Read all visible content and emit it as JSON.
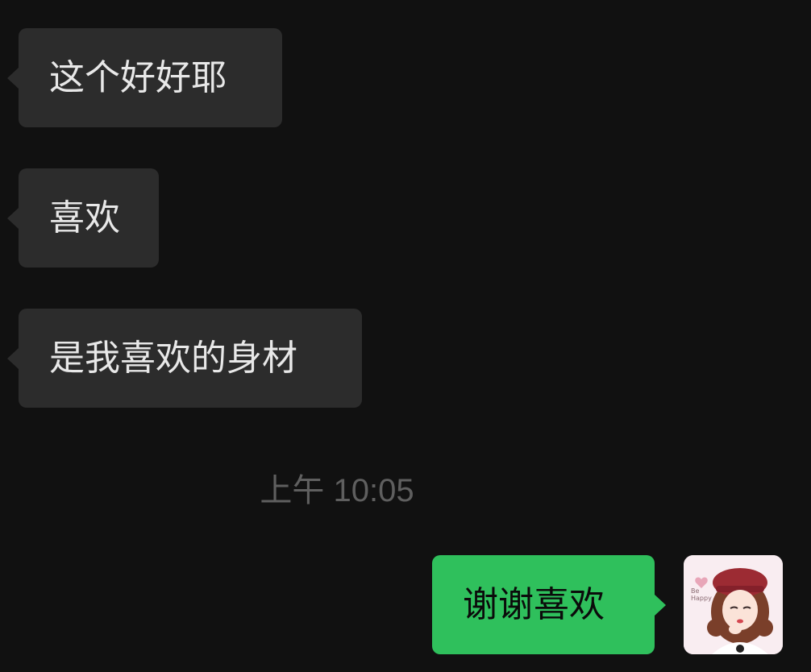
{
  "messages": [
    {
      "side": "incoming",
      "text": "这个好好耶"
    },
    {
      "side": "incoming",
      "text": "喜欢"
    },
    {
      "side": "incoming",
      "text": "是我喜欢的身材"
    },
    {
      "side": "outgoing",
      "text": "谢谢喜欢"
    }
  ],
  "timestamp": "上午 10:05",
  "avatar": {
    "icon": "avatar-girl-illustration",
    "caption": "Be Happy"
  },
  "colors": {
    "background": "#111111",
    "incoming_bubble": "#2c2c2c",
    "outgoing_bubble": "#2fc05c",
    "timestamp_text": "#5f5f5f"
  }
}
